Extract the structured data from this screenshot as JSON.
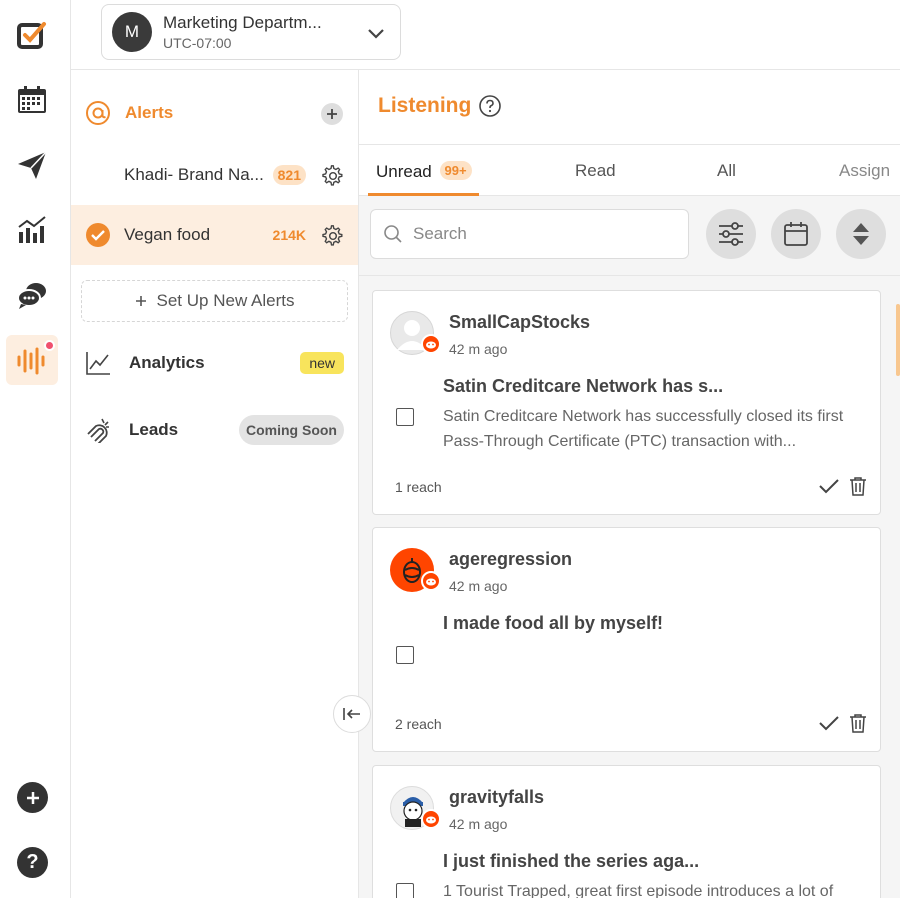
{
  "workspace": {
    "avatar_letter": "M",
    "name": "Marketing Departm...",
    "timezone": "UTC-07:00"
  },
  "rail": {
    "icons": [
      "app-logo-icon",
      "calendar-icon",
      "send-icon",
      "analytics-chart-icon",
      "chat-icon",
      "listening-icon",
      "add-icon",
      "help-icon"
    ],
    "help_label": "?"
  },
  "alerts": {
    "title": "Alerts",
    "items": [
      {
        "name": "Khadi- Brand Na...",
        "count": "821"
      },
      {
        "name": "Vegan food",
        "count": "214K"
      }
    ],
    "setup_label": "Set Up New Alerts"
  },
  "nav": {
    "analytics": {
      "label": "Analytics",
      "badge": "new"
    },
    "leads": {
      "label": "Leads",
      "badge": "Coming Soon"
    }
  },
  "listening": {
    "title": "Listening",
    "tabs": [
      {
        "label": "Unread",
        "count": "99+"
      },
      {
        "label": "Read"
      },
      {
        "label": "All"
      },
      {
        "label": "Assign"
      }
    ],
    "search_placeholder": "Search"
  },
  "posts": [
    {
      "author": "SmallCapStocks",
      "time": "42 m ago",
      "title": "Satin Creditcare Network has s...",
      "body": "Satin Creditcare Network has successfully closed its first Pass-Through Certificate (PTC) transaction with...",
      "reach": "1 reach"
    },
    {
      "author": "ageregression",
      "time": "42 m ago",
      "title": "I made food all by myself!",
      "body": "",
      "reach": "2 reach"
    },
    {
      "author": "gravityfalls",
      "time": "42 m ago",
      "title": "I just finished the series aga...",
      "body": "1 Tourist Trapped, great first episode introduces a lot of",
      "reach": ""
    }
  ],
  "colors": {
    "accent": "#ef8a2e",
    "reddit": "#ff4500",
    "badge_new": "#f8e45c",
    "notification_dot": "#f0506e"
  }
}
